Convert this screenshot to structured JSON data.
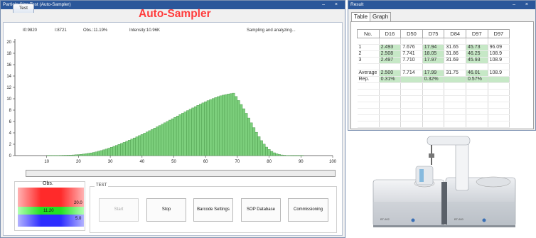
{
  "window_left": {
    "title": "Particle Size Test (Auto-Sampler)",
    "controls": "– ×"
  },
  "tab_test": "Test",
  "app_heading": "Auto-Sampler",
  "status": {
    "i0": "I0:9820",
    "i": "I:8721",
    "obs": "Obs.:11.19%",
    "intensity": "Intensity:10.96K",
    "message": "Sampling and analyzing..."
  },
  "chart_data": {
    "type": "bar",
    "title": "",
    "xlabel": "",
    "ylabel": "",
    "xlim": [
      0,
      100
    ],
    "ylim": [
      0,
      20
    ],
    "xticks": [
      10,
      20,
      30,
      40,
      50,
      60,
      70,
      80,
      90,
      100
    ],
    "yticks": [
      0,
      2,
      4,
      6,
      8,
      10,
      12,
      14,
      16,
      18,
      20
    ],
    "bar_color": "#7ccf7c",
    "bar_edge": "#3a8a3a",
    "grid": false,
    "x": [
      10.0,
      10.8,
      11.6,
      12.4,
      13.2,
      14.0,
      14.8,
      15.6,
      16.4,
      17.2,
      18.0,
      18.8,
      19.6,
      20.4,
      21.2,
      22.0,
      22.8,
      23.6,
      24.4,
      25.2,
      26.0,
      26.8,
      27.6,
      28.4,
      29.2,
      30.0,
      30.8,
      31.6,
      32.4,
      33.2,
      34.0,
      34.8,
      35.6,
      36.4,
      37.2,
      38.0,
      38.8,
      39.6,
      40.4,
      41.2,
      42.0,
      42.8,
      43.6,
      44.4,
      45.2,
      46.0,
      46.8,
      47.6,
      48.4,
      49.2,
      50.0,
      50.8,
      51.6,
      52.4,
      53.2,
      54.0,
      54.8,
      55.6,
      56.4,
      57.2,
      58.0,
      58.8,
      59.6,
      60.4,
      61.2,
      62.0,
      62.8,
      63.6,
      64.4,
      65.2,
      66.0,
      66.8,
      67.6,
      68.4,
      69.2,
      70.0,
      70.8,
      71.6,
      72.4,
      73.2,
      74.0,
      74.8,
      75.6,
      76.4,
      77.2,
      78.0,
      78.8,
      79.6,
      80.4,
      81.2,
      82.0,
      82.8,
      83.6,
      84.4,
      85.2,
      86.0,
      86.8,
      87.6,
      88.4,
      89.2,
      90.0,
      90.8,
      91.6,
      92.4,
      93.2,
      94.0
    ],
    "values": [
      0.02,
      0.02,
      0.03,
      0.03,
      0.04,
      0.05,
      0.06,
      0.07,
      0.08,
      0.1,
      0.12,
      0.15,
      0.18,
      0.22,
      0.27,
      0.33,
      0.4,
      0.48,
      0.56,
      0.66,
      0.77,
      0.89,
      1.02,
      1.16,
      1.31,
      1.47,
      1.63,
      1.8,
      1.97,
      2.15,
      2.33,
      2.52,
      2.71,
      2.91,
      3.11,
      3.31,
      3.52,
      3.73,
      3.95,
      4.17,
      4.39,
      4.61,
      4.84,
      5.07,
      5.3,
      5.53,
      5.77,
      6.01,
      6.25,
      6.49,
      6.73,
      6.97,
      7.21,
      7.45,
      7.69,
      7.93,
      8.16,
      8.39,
      8.62,
      8.84,
      9.06,
      9.27,
      9.48,
      9.68,
      9.87,
      10.05,
      10.22,
      10.38,
      10.52,
      10.64,
      10.74,
      10.84,
      10.92,
      10.99,
      10.4,
      9.7,
      9.0,
      8.25,
      7.45,
      6.62,
      5.77,
      4.93,
      4.11,
      3.34,
      2.64,
      2.02,
      1.5,
      1.08,
      0.75,
      0.5,
      0.32,
      0.2,
      0.12,
      0.07,
      0.04,
      0.02,
      0.01,
      0.01,
      0.01,
      0.01,
      0.01,
      0.0,
      0.0,
      0.0,
      0.0,
      0.0
    ]
  },
  "obs_gauge": {
    "label": "Obs.",
    "upper": "20.0",
    "current": "11.20",
    "lower": "5.0",
    "colors": {
      "high": "#ff2a2a",
      "ok": "#22e022",
      "low": "#2d2dff"
    }
  },
  "progress": 0,
  "test_group": {
    "legend": "TEST",
    "buttons": [
      {
        "label": "Start",
        "enabled": false
      },
      {
        "label": "Stop",
        "enabled": true
      },
      {
        "label": "Barcode Settings",
        "enabled": true
      },
      {
        "label": "SOP Database",
        "enabled": true
      },
      {
        "label": "Commissioning",
        "enabled": true
      }
    ]
  },
  "window_right": {
    "title": "Result",
    "controls": "– ×"
  },
  "result_tabs": [
    "Table",
    "Graph"
  ],
  "result_table": {
    "headers": [
      "No.",
      "D16",
      "D50",
      "D75",
      "D84",
      "D97",
      "D97"
    ],
    "rows": [
      [
        "1",
        "2.493",
        "7.676",
        "17.94",
        "31.65",
        "45.73",
        "96.09"
      ],
      [
        "2",
        "2.508",
        "7.741",
        "18.05",
        "31.86",
        "46.25",
        "108.9"
      ],
      [
        "3",
        "2.497",
        "7.710",
        "17.97",
        "31.69",
        "45.93",
        "108.9"
      ]
    ],
    "average": [
      "Average",
      "2.500",
      "7.714",
      "17.99",
      "31.75",
      "46.01",
      "108.9"
    ],
    "rep": [
      "Rep.",
      "0.31%",
      "",
      "0.32%",
      "",
      "0.57%",
      ""
    ]
  }
}
